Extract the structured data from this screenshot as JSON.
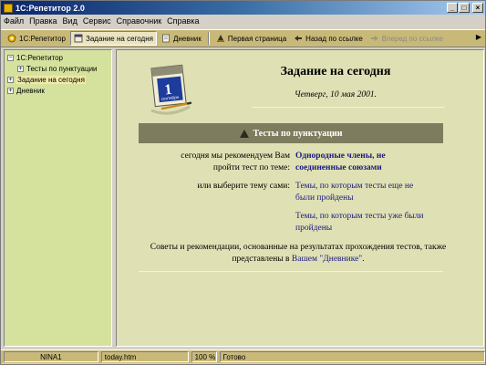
{
  "window": {
    "title": "1С:Репетитор 2.0",
    "buttons": {
      "minimize": "_",
      "maximize": "□",
      "close": "×"
    }
  },
  "menu": [
    "Файл",
    "Правка",
    "Вид",
    "Сервис",
    "Справочник",
    "Справка"
  ],
  "toolbar": {
    "items": [
      {
        "label": "1С:Репетитор",
        "icon": "home-icon"
      },
      {
        "label": "Задание на сегодня",
        "icon": "calendar-icon",
        "pressed": true
      },
      {
        "label": "Дневник",
        "icon": "diary-icon"
      },
      {
        "label": "Первая страница",
        "icon": "first-page-icon"
      },
      {
        "label": "Назад по ссылке",
        "icon": "back-arrow-icon"
      },
      {
        "label": "Вперед по ссылке",
        "icon": "forward-arrow-icon",
        "disabled": true
      }
    ],
    "more": "▶"
  },
  "tree": [
    {
      "label": "1С:Репетитор",
      "toggle": "−",
      "level": 0
    },
    {
      "label": "Тесты по пунктуации",
      "toggle": "+",
      "level": 1
    },
    {
      "label": "Задание на сегодня",
      "toggle": "+",
      "level": 0,
      "selected": true
    },
    {
      "label": "Дневник",
      "toggle": "+",
      "level": 0
    }
  ],
  "content": {
    "calendar": {
      "day": "1",
      "month": "сентября"
    },
    "heading": "Задание на сегодня",
    "date": "Четверг, 10 мая 2001.",
    "band_title": "Тесты по пунктуации",
    "recommend_label": "сегодня мы рекомендуем Вам пройти тест по теме:",
    "recommend_link": "Однородные члены, не соединенные союзами",
    "choose_label": "или выберите тему сами:",
    "choose_link_1": "Темы, по которым тесты еще не были пройдены",
    "choose_link_2": "Темы, по которым тесты уже были пройдены",
    "tips_text": "Советы и рекомендации, основанные на результатах прохождения тестов, также представлены в",
    "tips_link": "Вашем \"Дневнике\"",
    "tips_end": "."
  },
  "status": {
    "user": "NINA1",
    "file": "today.htm",
    "zoom": "100 %",
    "state": "Готово"
  },
  "colors": {
    "title_bar": "#0a246a",
    "toolbar_bg": "#c9b979",
    "tree_bg": "#d5e29e",
    "content_bg": "#dfe0b4",
    "band_bg": "#7e7c5e",
    "link": "#1a1a80"
  }
}
